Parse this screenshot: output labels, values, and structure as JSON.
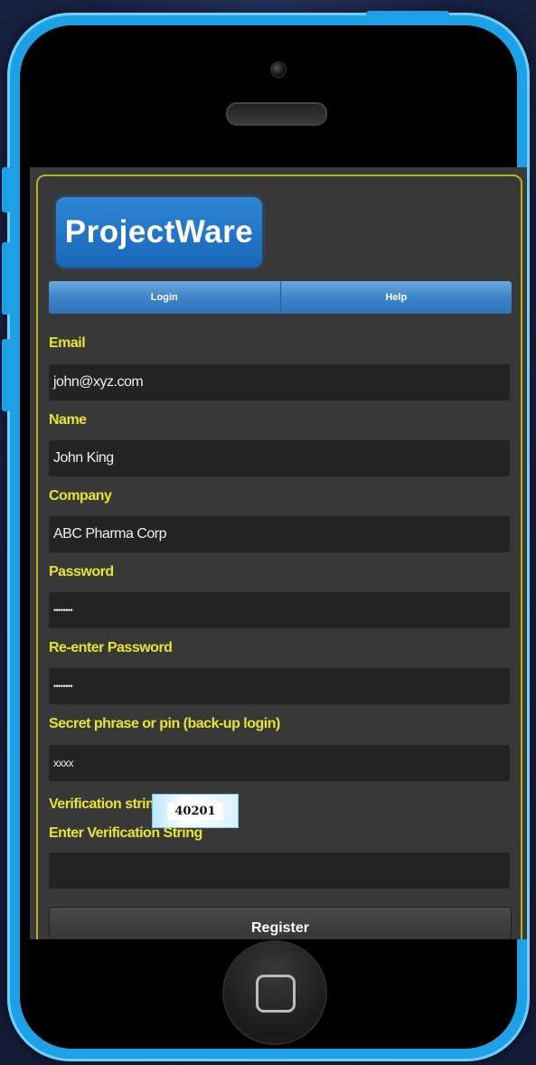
{
  "app": {
    "logo_text": "ProjectWare"
  },
  "nav": {
    "tabs": [
      {
        "label": "Login"
      },
      {
        "label": "Help"
      }
    ]
  },
  "form": {
    "email": {
      "label": "Email",
      "value": "john@xyz.com"
    },
    "name": {
      "label": "Name",
      "value": "John King"
    },
    "company": {
      "label": "Company",
      "value": "ABC Pharma Corp"
    },
    "password": {
      "label": "Password",
      "value": "••••••••"
    },
    "reenter_password": {
      "label": "Re-enter Password",
      "value": "••••••••"
    },
    "secret": {
      "label": "Secret phrase or pin (back-up login)",
      "value": "xxxx"
    },
    "verification": {
      "label": "Verification string",
      "captcha": "40201"
    },
    "enter_verification": {
      "label": "Enter Verification String",
      "value": ""
    },
    "register_label": "Register"
  },
  "colors": {
    "phone": "#1ea0e6",
    "label": "#e6e630",
    "panel_border": "#b5b51a",
    "nav": "#3d84c8"
  },
  "icons": {
    "home_button": "home-square-icon",
    "camera": "camera-icon",
    "speaker": "speaker-icon"
  }
}
